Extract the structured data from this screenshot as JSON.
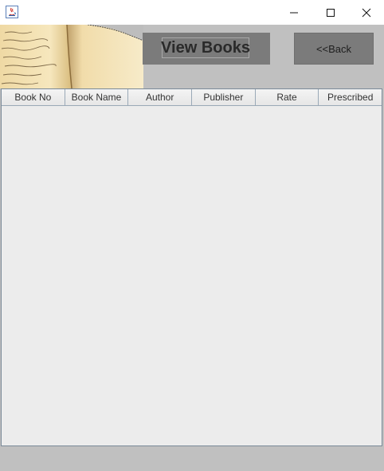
{
  "window": {
    "min_icon": "minimize-icon",
    "max_icon": "maximize-icon",
    "close_icon": "close-icon",
    "app_icon": "java-app-icon"
  },
  "header": {
    "title": "View Books",
    "back_label": "<<Back"
  },
  "table": {
    "columns": [
      "Book No",
      "Book Name",
      "Author",
      "Publisher",
      "Rate",
      "Prescribed"
    ],
    "rows": []
  },
  "colors": {
    "panel": "#7b7b7b",
    "background": "#c0c0c0",
    "table_bg": "#eeeeee"
  }
}
